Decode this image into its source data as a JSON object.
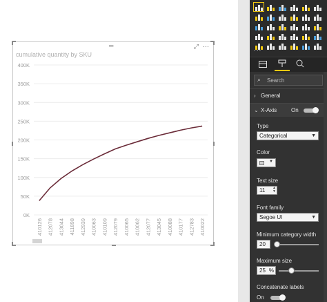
{
  "visual": {
    "title": "cumulative quantity by SKU",
    "grip": "═",
    "focus_icon": "⤢",
    "more_icon": "⋯"
  },
  "chart_data": {
    "type": "line",
    "title": "cumulative quantity by SKU",
    "categories": [
      "410126",
      "412078",
      "413044",
      "411898",
      "412939",
      "410063",
      "410109",
      "412079",
      "410065",
      "410062",
      "412077",
      "413045",
      "410088",
      "410177",
      "412783",
      "410022"
    ],
    "y_ticks": [
      "400K",
      "350K",
      "300K",
      "250K",
      "200K",
      "150K",
      "100K",
      "50K",
      "0K"
    ],
    "ylim": [
      0,
      400000
    ],
    "series": [
      {
        "values": [
          38000,
          72000,
          97000,
          117000,
          134000,
          149000,
          163000,
          176000,
          186000,
          195000,
          204000,
          212000,
          219000,
          226000,
          232000,
          237000
        ],
        "color": "#6b2c39"
      }
    ],
    "grid": true,
    "legend": "none"
  },
  "tabs": {
    "fields_icon": "fields-icon",
    "format_icon": "paint-roller-icon",
    "analytics_icon": "analytics-icon"
  },
  "pane": {
    "search_placeholder": "Search",
    "general_label": "General",
    "xaxis_label": "X-Axis",
    "xaxis_state": "On",
    "type_label": "Type",
    "type_value": "Categorical",
    "color_label": "Color",
    "text_size_label": "Text size",
    "text_size_value": "11",
    "font_family_label": "Font family",
    "font_family_value": "Segoe UI",
    "min_cat_width_label": "Minimum category width",
    "min_cat_width_value": "20",
    "max_size_label": "Maximum size",
    "max_size_value": "25",
    "max_size_unit": "%",
    "concat_label": "Concatenate labels",
    "concat_state": "On"
  },
  "gallery": {
    "more": "..."
  }
}
